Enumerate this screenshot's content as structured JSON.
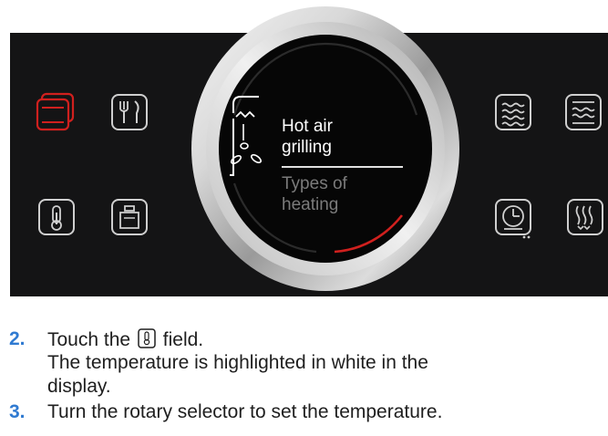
{
  "colors": {
    "panel_bg": "#141415",
    "icon_default": "#cfcfcf",
    "icon_active": "#d0201e",
    "step_number": "#2f7ad1",
    "display_primary": "#ffffff",
    "display_secondary": "#7b7b7b",
    "progress_arc": "#d0201e"
  },
  "panel": {
    "left_buttons": [
      {
        "icon": "types-of-heating-icon",
        "state": "active"
      },
      {
        "icon": "meat-program-icon",
        "state": "default"
      },
      {
        "icon": "temperature-icon",
        "state": "default"
      },
      {
        "icon": "weight-icon",
        "state": "default"
      }
    ],
    "right_buttons": [
      {
        "icon": "microwave-icon",
        "state": "default"
      },
      {
        "icon": "steam-icon",
        "state": "default"
      },
      {
        "icon": "timer-icon",
        "state": "default"
      },
      {
        "icon": "reheat-icon",
        "state": "default"
      }
    ]
  },
  "display": {
    "heating_icon": "hot-air-grilling-icon",
    "line1": "Hot air",
    "line2": "grilling",
    "line3": "Types of",
    "line4": "heating"
  },
  "instructions": [
    {
      "number": "2.",
      "lines": [
        "Touch the",
        "field.",
        "The temperature is highlighted in white in the",
        "display."
      ],
      "inline_icon": "temperature-icon"
    },
    {
      "number": "3.",
      "lines": [
        "Turn the rotary selector to set the temperature."
      ]
    }
  ]
}
